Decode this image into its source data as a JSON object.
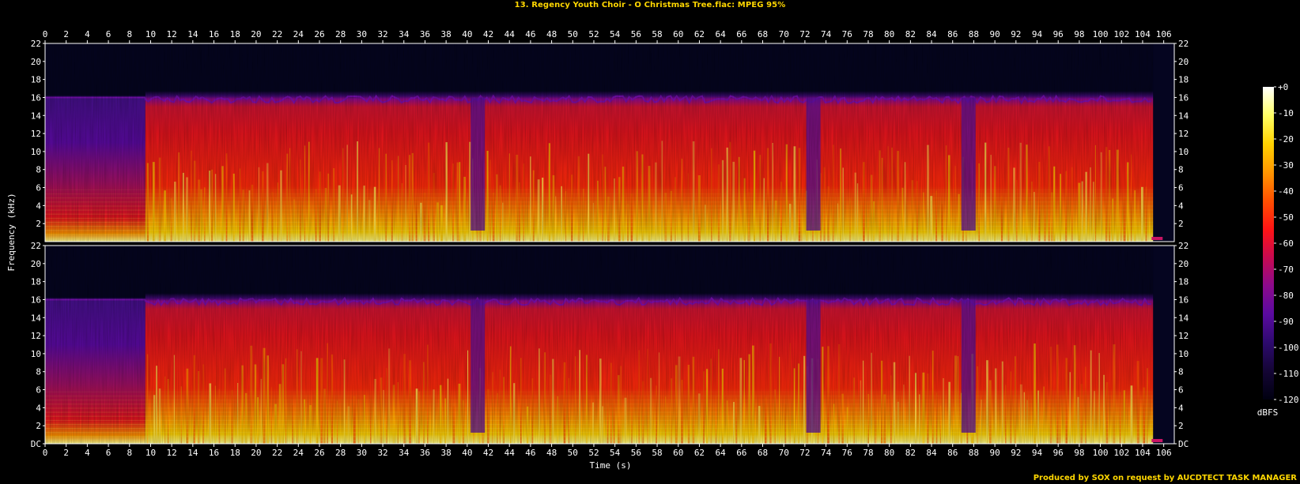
{
  "header": {
    "title": "13. Regency Youth Choir - O Christmas Tree.flac: MPEG 95%"
  },
  "footer": {
    "credit": "Produced by SOX on request by AUCDTECT TASK MANAGER"
  },
  "chart_data": {
    "type": "heatmap",
    "title": "13. Regency Youth Choir - O Christmas Tree.flac: MPEG 95%",
    "xlabel": "Time (s)",
    "ylabel": "Frequency (kHz)",
    "xlim": [
      0,
      107
    ],
    "ylim": [
      0,
      22
    ],
    "x_ticks": [
      0,
      2,
      4,
      6,
      8,
      10,
      12,
      14,
      16,
      18,
      20,
      22,
      24,
      26,
      28,
      30,
      32,
      34,
      36,
      38,
      40,
      42,
      44,
      46,
      48,
      50,
      52,
      54,
      56,
      58,
      60,
      62,
      64,
      66,
      68,
      70,
      72,
      74,
      76,
      78,
      80,
      82,
      84,
      86,
      88,
      90,
      92,
      94,
      96,
      98,
      100,
      102,
      104,
      106
    ],
    "y_tick_labels": [
      "DC",
      "2",
      "4",
      "6",
      "8",
      "10",
      "12",
      "14",
      "16",
      "18",
      "20",
      "22"
    ],
    "y_tick_values": [
      0,
      2,
      4,
      6,
      8,
      10,
      12,
      14,
      16,
      18,
      20,
      22
    ],
    "channels": [
      {
        "top_tick_label": "22"
      },
      {
        "top_tick_label": "22"
      }
    ],
    "colorbar": {
      "label": "dBFS",
      "range": [
        -120,
        0
      ],
      "tick_labels": [
        "+0",
        "-10",
        "-20",
        "-30",
        "-40",
        "-50",
        "-60",
        "-70",
        "-80",
        "-90",
        "-100",
        "-110",
        "-120"
      ],
      "tick_values": [
        0,
        -10,
        -20,
        -30,
        -40,
        -50,
        -60,
        -70,
        -80,
        -90,
        -100,
        -110,
        -120
      ],
      "colors": [
        "#000010",
        "#140535",
        "#2d0a6e",
        "#5a0aa0",
        "#8c0a8c",
        "#c80a50",
        "#ff1414",
        "#ff5000",
        "#ff9600",
        "#ffd200",
        "#ffff64",
        "#ffffff"
      ]
    },
    "lowpass_cutoff_khz": 16,
    "audio_end_s": 105,
    "quiet_intro_end_s": 9.5,
    "dips_s": [
      41,
      72.8,
      87.5
    ]
  }
}
